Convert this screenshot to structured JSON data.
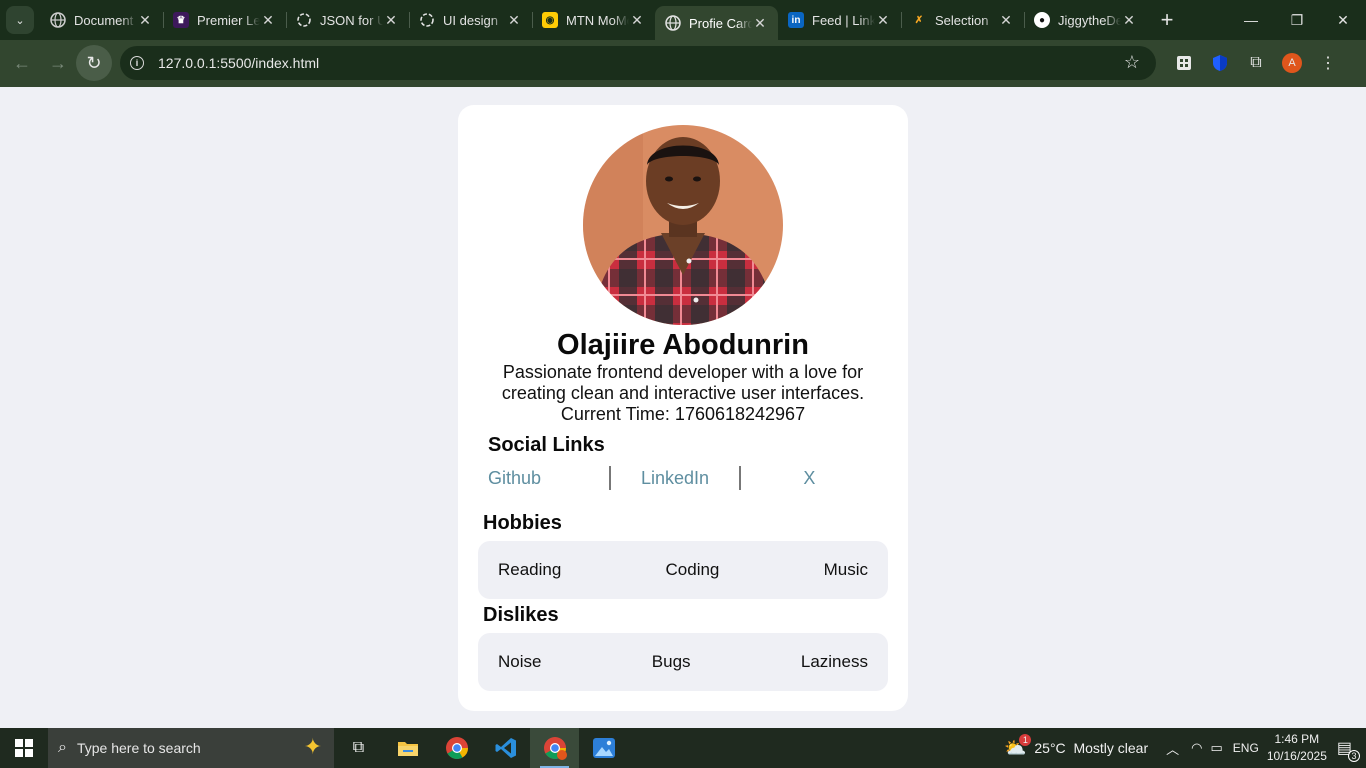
{
  "browser": {
    "tabs": [
      {
        "title": "Document",
        "favicon": "globe-icon"
      },
      {
        "title": "Premier League",
        "favicon": "premier-league-icon"
      },
      {
        "title": "JSON for UI",
        "favicon": "openai-icon"
      },
      {
        "title": "UI design",
        "favicon": "openai-icon"
      },
      {
        "title": "MTN MoMo",
        "favicon": "mtn-icon"
      },
      {
        "title": "Profie Card",
        "favicon": "globe-icon",
        "active": true
      },
      {
        "title": "Feed | LinkedIn",
        "favicon": "linkedin-icon"
      },
      {
        "title": "Selection",
        "favicon": "selection-icon"
      },
      {
        "title": "JiggytheDev",
        "favicon": "github-icon"
      }
    ],
    "url": "127.0.0.1:5500/index.html",
    "profile_initial": "A"
  },
  "profile": {
    "name": "Olajiire Abodunrin",
    "bio": "Passionate frontend developer with a love for creating clean and interactive user interfaces.",
    "time_label": "Current Time: 1760618242967",
    "social_title": "Social Links",
    "social_links": [
      "Github",
      "LinkedIn",
      "X"
    ],
    "hobbies_title": "Hobbies",
    "hobbies": [
      "Reading",
      "Coding",
      "Music"
    ],
    "dislikes_title": "Dislikes",
    "dislikes": [
      "Noise",
      "Bugs",
      "Laziness"
    ]
  },
  "taskbar": {
    "search_placeholder": "Type here to search",
    "weather_badge": "1",
    "weather": "25°C  Mostly clear",
    "language": "ENG",
    "time": "1:46 PM",
    "date": "10/16/2025",
    "notification_count": "3"
  },
  "colors": {
    "accent_link": "#5e8ea0",
    "chrome_dark": "#1a2e1b",
    "chrome_mid": "#32462f",
    "page_bg": "#eff0f5"
  }
}
